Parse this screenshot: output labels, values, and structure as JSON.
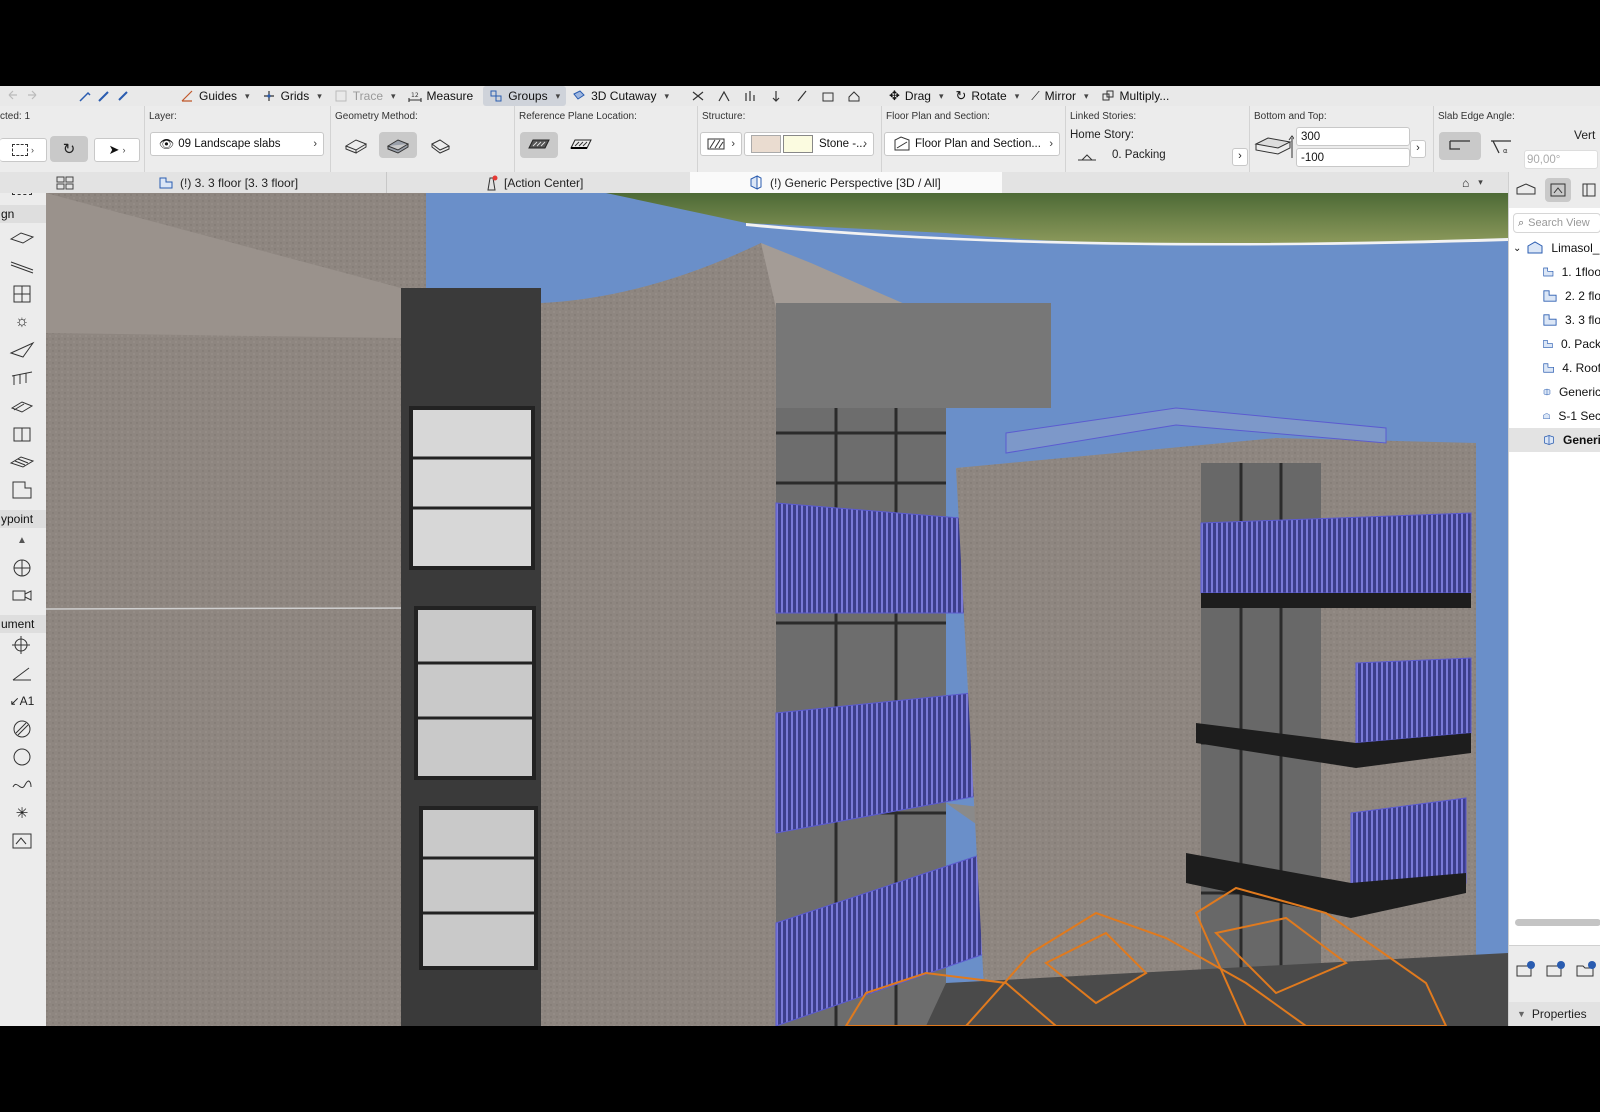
{
  "toolbar": {
    "guides": "Guides",
    "grids": "Grids",
    "trace": "Trace",
    "measure": "Measure",
    "groups": "Groups",
    "cutaway": "3D Cutaway",
    "drag": "Drag",
    "rotate": "Rotate",
    "mirror": "Mirror",
    "multiply": "Multiply..."
  },
  "infobox": {
    "selected": "cted: 1",
    "layer": {
      "title": "Layer:",
      "value": "09 Landscape slabs"
    },
    "geometry": {
      "title": "Geometry Method:"
    },
    "ref_plane": {
      "title": "Reference Plane Location:"
    },
    "structure": {
      "title": "Structure:",
      "value": "Stone -..."
    },
    "floor_plan": {
      "title": "Floor Plan and Section:",
      "value": "Floor Plan and Section..."
    },
    "linked": {
      "title": "Linked Stories:",
      "home_story_label": "Home Story:",
      "home_story_value": "0. Packing"
    },
    "bottom_top": {
      "title": "Bottom and Top:",
      "top_value": "300",
      "bottom_value": "-100"
    },
    "edge_angle": {
      "title": "Slab Edge Angle:",
      "vert_label": "Vert",
      "angle_value": "90,00°"
    }
  },
  "tabs": [
    {
      "label": "(!) 3. 3 floor  [3. 3 floor]"
    },
    {
      "label": "[Action Center]"
    },
    {
      "label": "(!) Generic Perspective [3D / All]"
    }
  ],
  "toolbox": {
    "group_design": "gn",
    "group_viewpoint": "ypoint",
    "group_document": "ument"
  },
  "navigator": {
    "search_placeholder": "Search View",
    "project": "Limasol_",
    "items": [
      {
        "label": "1. 1floo",
        "icon": "story-icon"
      },
      {
        "label": "2. 2 flo",
        "icon": "story-icon"
      },
      {
        "label": "3. 3 flo",
        "icon": "story-icon"
      },
      {
        "label": "0. Pack",
        "icon": "story-icon"
      },
      {
        "label": "4. Roof",
        "icon": "story-icon"
      },
      {
        "label": "Generic",
        "icon": "3d-view-icon"
      },
      {
        "label": "S-1 Sec",
        "icon": "section-icon"
      },
      {
        "label": "Generi",
        "icon": "3d-view-icon",
        "selected": true
      }
    ],
    "properties_label": "Properties"
  },
  "colors": {
    "sky": "#6a8fc9",
    "concrete": "#8e8680",
    "railing": "#4f4fb2",
    "car_wire": "#e07a1e"
  }
}
